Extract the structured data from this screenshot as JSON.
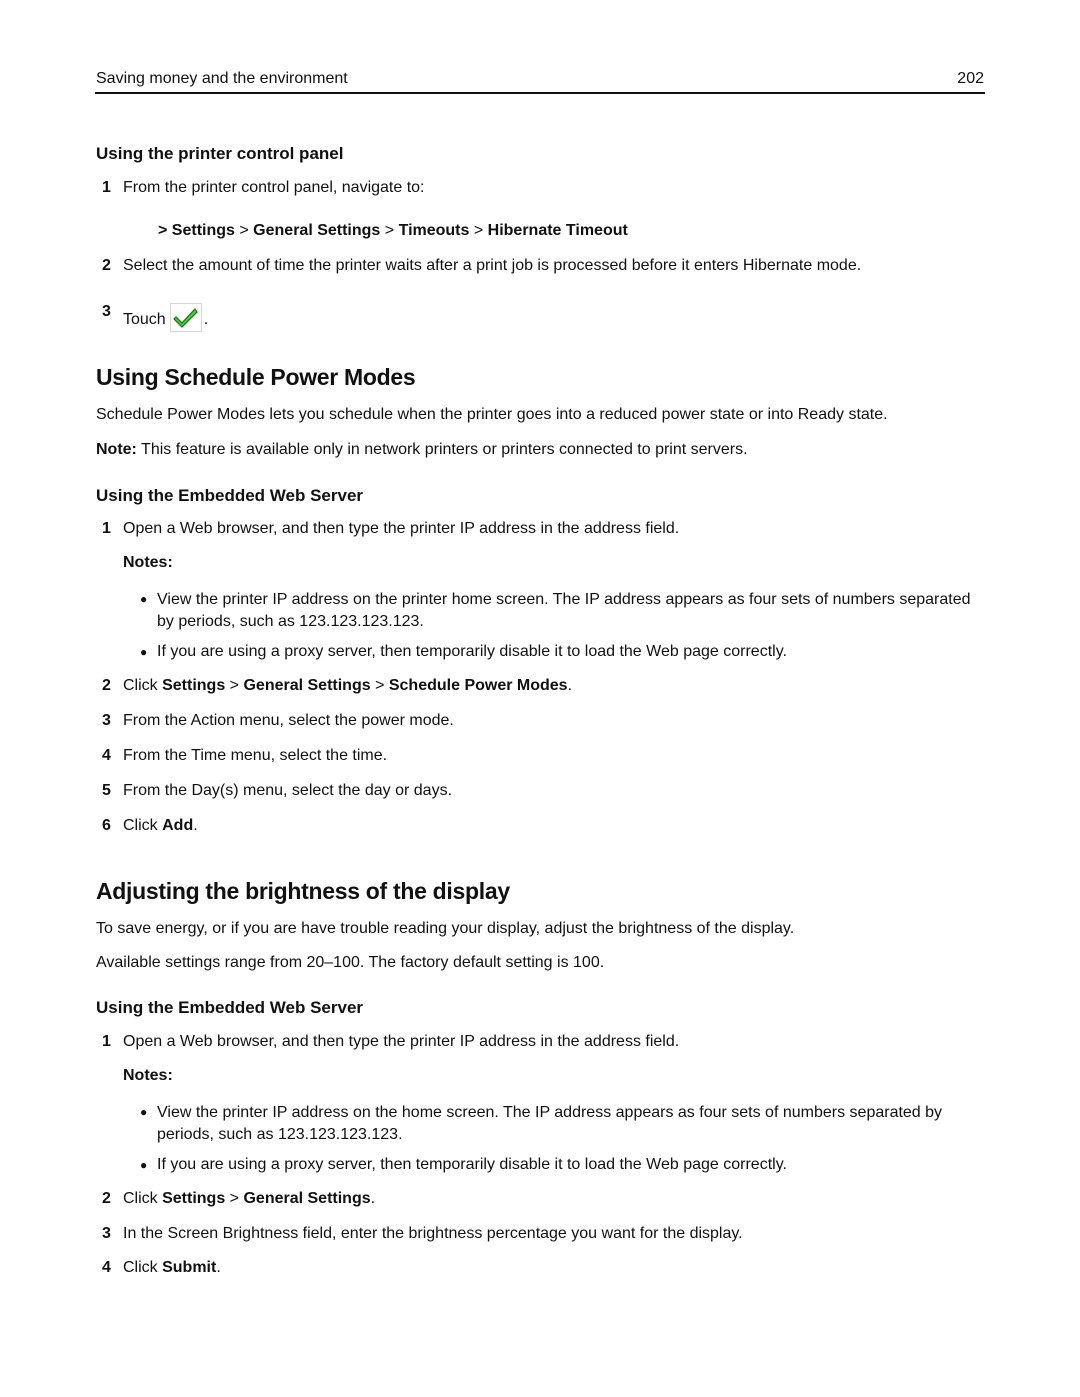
{
  "header": {
    "title": "Saving money and the environment",
    "page_number": "202"
  },
  "section_control_panel": {
    "heading": "Using the printer control panel",
    "steps": [
      {
        "num": "1",
        "text": "From the printer control panel, navigate to:"
      },
      {
        "num": "2",
        "text": "Select the amount of time the printer waits after a print job is processed before it enters Hibernate mode."
      },
      {
        "num": "3",
        "text": "Touch",
        "suffix": "."
      }
    ],
    "path": {
      "sep": ">",
      "items": [
        "Settings",
        "General Settings",
        "Timeouts",
        "Hibernate Timeout"
      ]
    },
    "check_icon": "green-checkmark-icon",
    "check_color": "#3fcf3a"
  },
  "section_schedule": {
    "title": "Using Schedule Power Modes",
    "intro": "Schedule Power Modes lets you schedule when the printer goes into a reduced power state or into Ready state.",
    "note_label": "Note:",
    "note_text": " This feature is available only in network printers or printers connected to print servers.",
    "ews_heading": "Using the Embedded Web Server",
    "step1": {
      "num": "1",
      "text": "Open a Web browser, and then type the printer IP address in the address field."
    },
    "notes_label": "Notes:",
    "bullets": [
      "View the printer IP address on the printer home screen. The IP address appears as four sets of numbers separated by periods, such as 123.123.123.123.",
      "If you are using a proxy server, then temporarily disable it to load the Web page correctly."
    ],
    "step2": {
      "num": "2",
      "prefix": "Click ",
      "b1": "Settings",
      "sep1": " > ",
      "b2": "General Settings",
      "sep2": " > ",
      "b3": "Schedule Power Modes",
      "suffix": "."
    },
    "step3": {
      "num": "3",
      "text": "From the Action menu, select the power mode."
    },
    "step4": {
      "num": "4",
      "text": "From the Time menu, select the time."
    },
    "step5": {
      "num": "5",
      "text": "From the Day(s) menu, select the day or days."
    },
    "step6": {
      "num": "6",
      "prefix": "Click ",
      "bold": "Add",
      "suffix": "."
    }
  },
  "section_brightness": {
    "title": "Adjusting the brightness of the display",
    "intro": "To save energy, or if you are have trouble reading your display, adjust the brightness of the display.",
    "range": "Available settings range from 20–100. The factory default setting is 100.",
    "ews_heading": "Using the Embedded Web Server",
    "step1": {
      "num": "1",
      "text": "Open a Web browser, and then type the printer IP address in the address field."
    },
    "notes_label": "Notes:",
    "bullets": [
      "View the printer IP address on the home screen. The IP address appears as four sets of numbers separated by periods, such as 123.123.123.123.",
      "If you are using a proxy server, then temporarily disable it to load the Web page correctly."
    ],
    "step2": {
      "num": "2",
      "prefix": "Click ",
      "b1": "Settings",
      "sep1": " > ",
      "b2": "General Settings",
      "suffix": "."
    },
    "step3": {
      "num": "3",
      "text": "In the Screen Brightness field, enter the brightness percentage you want for the display."
    },
    "step4": {
      "num": "4",
      "prefix": "Click ",
      "bold": "Submit",
      "suffix": "."
    }
  }
}
